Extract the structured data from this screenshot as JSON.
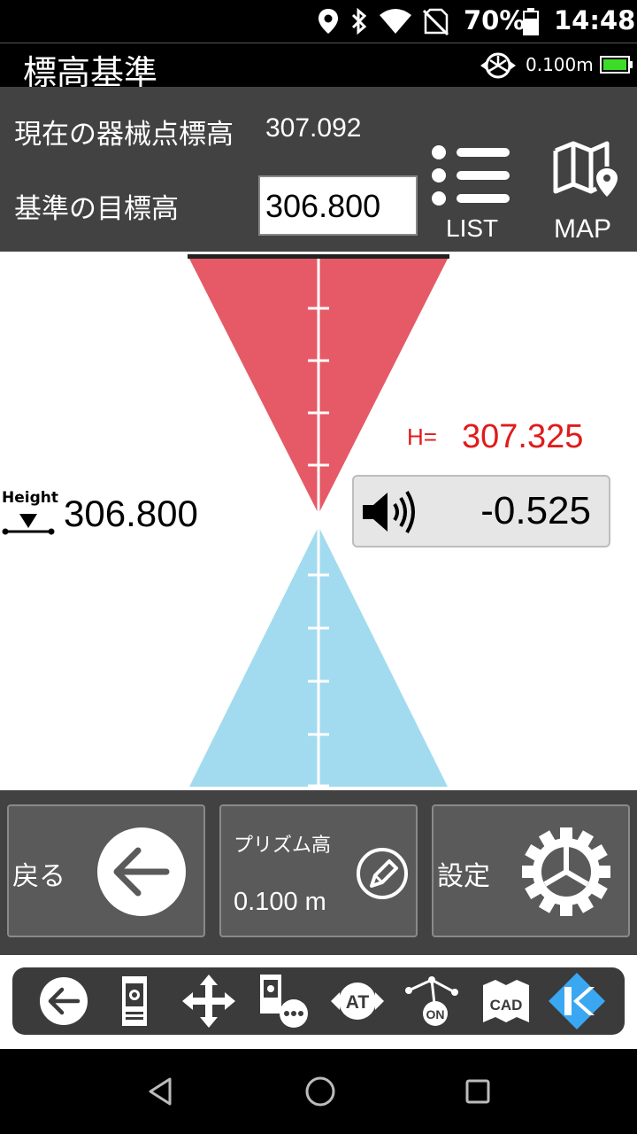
{
  "status_bar": {
    "battery_percent": "70%",
    "time": "14:48",
    "icons": [
      "location-icon",
      "bluetooth-icon",
      "wifi-icon",
      "no-sim-icon",
      "battery-icon"
    ]
  },
  "title_bar": {
    "title": "標高基準",
    "prism_height": "0.100m",
    "colors": {
      "battery_fill": "#3ddc29"
    }
  },
  "info": {
    "current_label": "現在の器械点標高",
    "current_value": "307.092",
    "target_label": "基準の目標高",
    "target_value": "306.800",
    "list_label": "LIST",
    "map_label": "MAP"
  },
  "graphic": {
    "colors": {
      "upper": "#e55a66",
      "lower": "#a2dbef"
    },
    "h_label": "H=",
    "h_value": "307.325",
    "difference": "-0.525",
    "height_tag": "Height",
    "height_value": "306.800"
  },
  "buttons": {
    "back_label": "戻る",
    "prism_label": "プリズム高",
    "prism_value": "0.100  m",
    "settings_label": "設定"
  },
  "toolbar": {
    "items": [
      "back-icon",
      "instrument-icon",
      "move-icon",
      "instrument-more-icon",
      "at-icon",
      "on-icon",
      "cad-icon",
      "k-logo-icon"
    ],
    "at_text": "AT",
    "on_text": "ON",
    "cad_text": "CAD"
  },
  "nav": {
    "items": [
      "back-triangle-icon",
      "home-circle-icon",
      "recents-square-icon"
    ]
  }
}
